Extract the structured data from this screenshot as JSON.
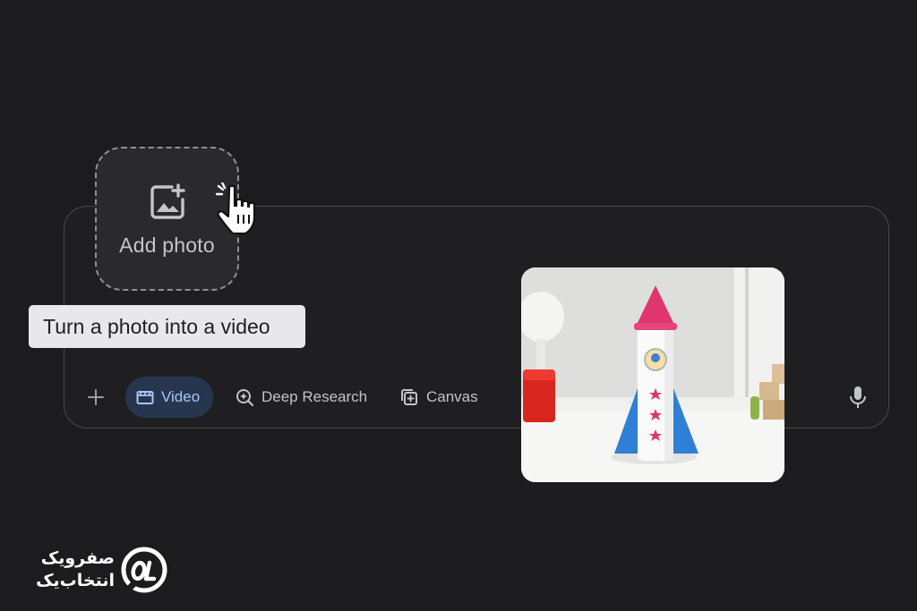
{
  "add_photo": {
    "label": "Add photo",
    "icon": "add-photo-icon"
  },
  "tooltip": {
    "text": "Turn a photo into a video"
  },
  "toolbar": {
    "plus_icon": "plus-icon",
    "video_label": "Video",
    "deep_research_label": "Deep Research",
    "canvas_label": "Canvas",
    "mic_icon": "mic-icon"
  },
  "colors": {
    "accent_chip_bg": "#26364f",
    "accent_chip_text": "#a9c6f5",
    "rocket_cone": "#e0366f",
    "rocket_fin": "#2f7fd6"
  },
  "watermark": {
    "line1": "صفرویک",
    "line2": "انتخاب‌یک"
  }
}
